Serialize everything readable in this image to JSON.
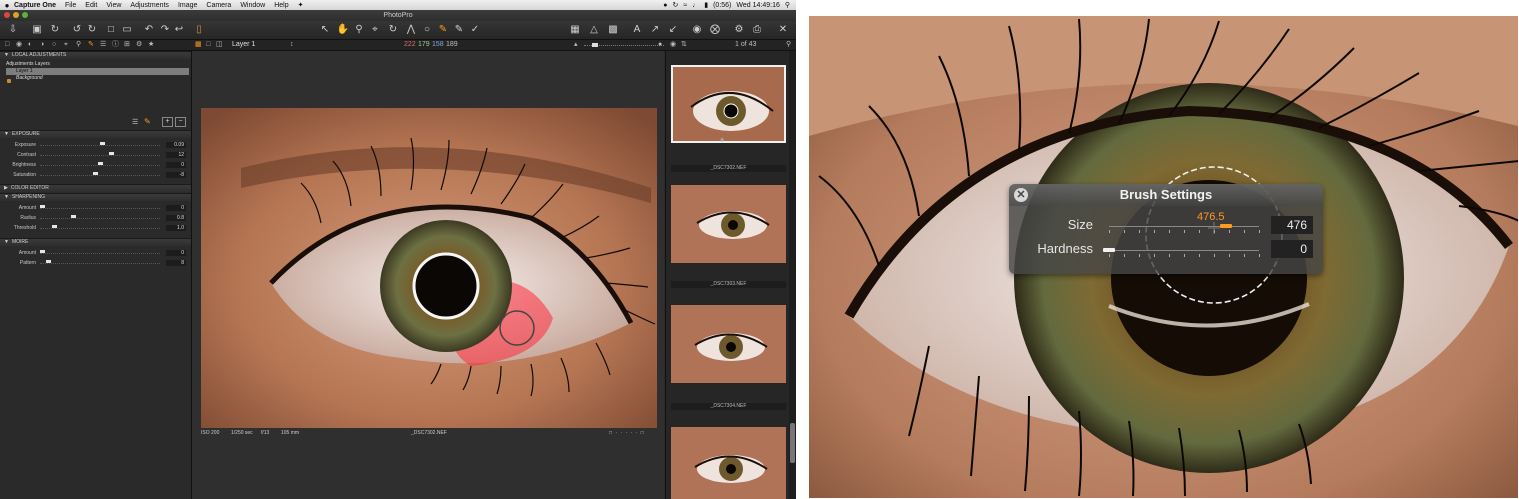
{
  "menubar": {
    "apple": "",
    "items": [
      "Capture One",
      "File",
      "Edit",
      "View",
      "Adjustments",
      "Image",
      "Camera",
      "Window",
      "Help"
    ],
    "battery": "(0:56)",
    "clock": "Wed 14:49:16"
  },
  "window": {
    "title": "PhotoPro"
  },
  "toolbar2": {
    "layer_select": "Layer 1",
    "rgb_r": "222",
    "rgb_g": "179",
    "rgb_b": "158",
    "rgb_l": "189",
    "counter": "1 of 43"
  },
  "sidebar": {
    "local_adjustments": "LOCAL ADJUSTMENTS",
    "layers_heading": "Adjustments Layers",
    "layers": [
      "Layer 1",
      "Background"
    ],
    "exposure": {
      "title": "EXPOSURE",
      "rows": [
        {
          "label": "Exposure",
          "value": "0.09",
          "level": 0.52
        },
        {
          "label": "Contrast",
          "value": "12",
          "level": 0.6
        },
        {
          "label": "Brightness",
          "value": "0",
          "level": 0.5
        },
        {
          "label": "Saturation",
          "value": "-8",
          "level": 0.46
        }
      ]
    },
    "color_editor": "COLOR EDITOR",
    "sharpening": {
      "title": "SHARPENING",
      "rows": [
        {
          "label": "Amount",
          "value": "0",
          "level": 0.0
        },
        {
          "label": "Radius",
          "value": "0.8",
          "level": 0.27
        },
        {
          "label": "Threshold",
          "value": "1.0",
          "level": 0.1
        }
      ]
    },
    "moire": {
      "title": "MOIRE",
      "rows": [
        {
          "label": "Amount",
          "value": "0",
          "level": 0.0
        },
        {
          "label": "Pattern",
          "value": "8",
          "level": 0.05
        }
      ]
    }
  },
  "viewer": {
    "iso": "ISO 200",
    "shutter": "1/250 sec",
    "aperture": "f/13",
    "focal": "105 mm",
    "filename": "_DSC7302.NEF"
  },
  "browser": {
    "thumbnails": [
      {
        "label": "_DSC7302.NEF"
      },
      {
        "label": "_DSC7303.NEF"
      },
      {
        "label": "_DSC7304.NEF"
      },
      {
        "label": ""
      }
    ]
  },
  "brush_settings": {
    "title": "Brush Settings",
    "size_label": "Size",
    "size_live": "476.5",
    "size_value": "476",
    "size_level": 0.78,
    "hardness_label": "Hardness",
    "hardness_value": "0",
    "hardness_level": 0.0
  },
  "colors": {
    "accent_orange": "#ff9a1f",
    "mask_red": "#ff2a3a",
    "panel_bg": "#2a2a2a"
  }
}
